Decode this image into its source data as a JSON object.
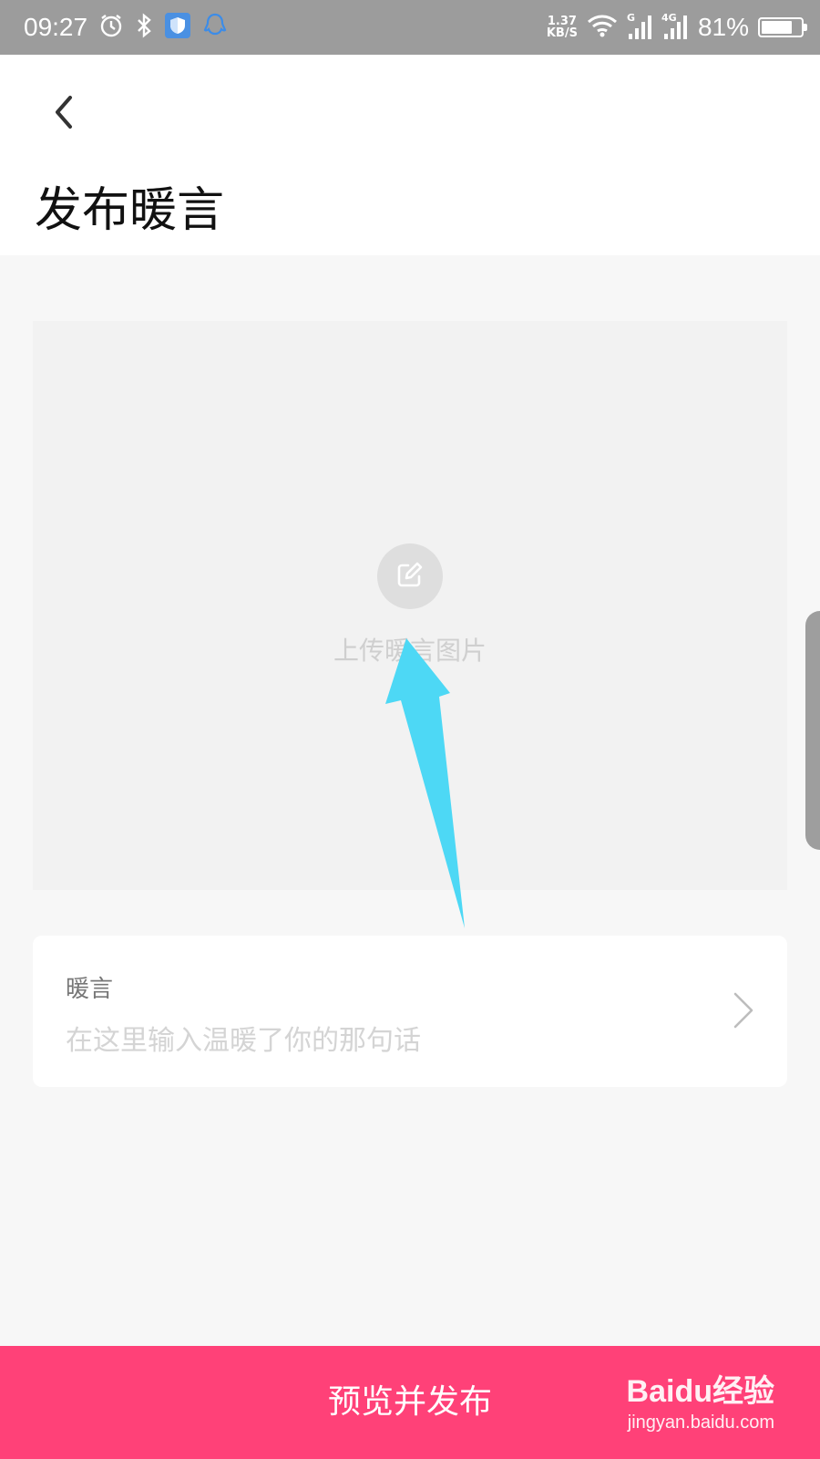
{
  "status_bar": {
    "time": "09:27",
    "speed_value": "1.37",
    "speed_unit": "KB/S",
    "network_1": "G",
    "network_2": "4G",
    "battery_percent": "81%",
    "battery_level": 0.81,
    "icons": [
      "alarm-icon",
      "bluetooth-icon",
      "shield-icon",
      "qq-icon",
      "wifi-icon",
      "signal-icon",
      "signal-icon",
      "battery-icon"
    ]
  },
  "header": {
    "back_icon": "chevron-left-icon",
    "title": "发布暖言"
  },
  "upload": {
    "icon": "edit-icon",
    "label": "上传暖言图片"
  },
  "input": {
    "label": "暖言",
    "placeholder": "在这里输入温暖了你的那句话",
    "chevron_icon": "chevron-right-icon"
  },
  "footer": {
    "button_label": "预览并发布",
    "watermark_logo": "Baidu经验",
    "watermark_url": "jingyan.baidu.com"
  },
  "colors": {
    "accent": "#ff4178",
    "annotation_arrow": "#4dd8f5",
    "status_bar": "#9c9c9c"
  }
}
